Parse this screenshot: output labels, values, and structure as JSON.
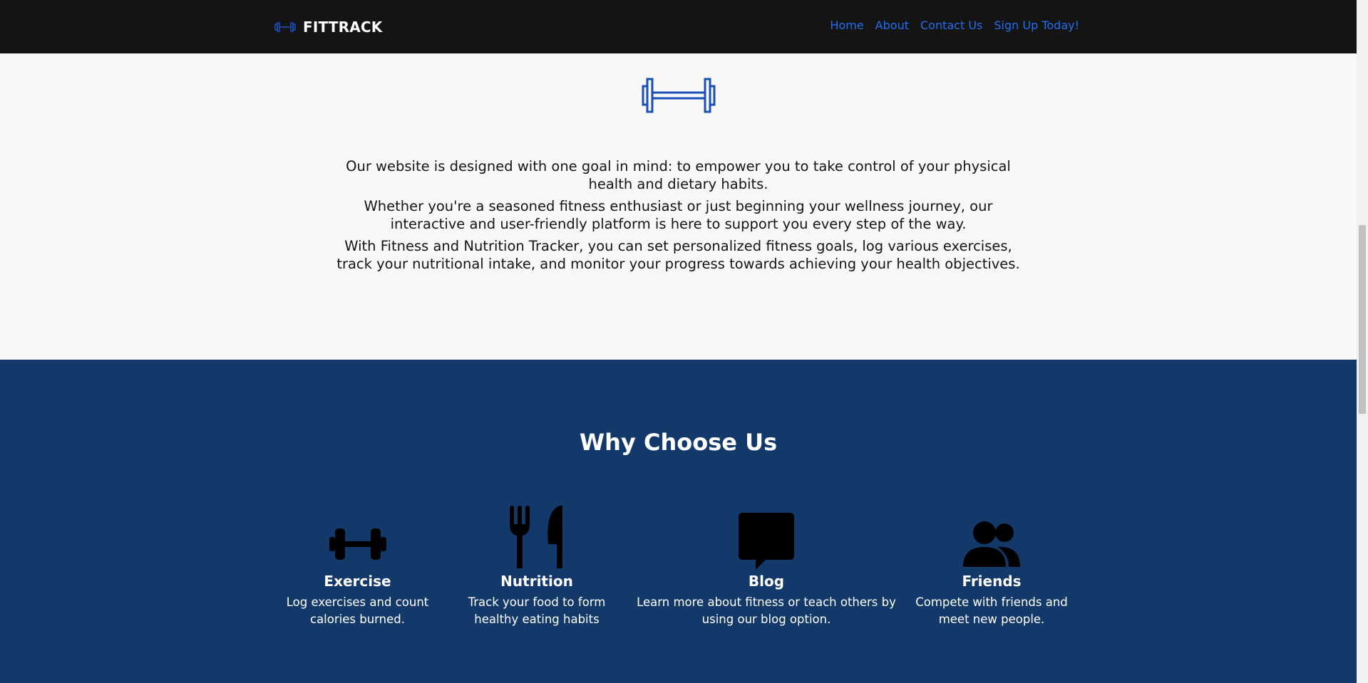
{
  "colors": {
    "nav_bg": "#141414",
    "accent": "#1f6ff0",
    "icon_blue": "#1a4fb6",
    "features_bg": "#13396b",
    "page_bg": "#f8f8f8"
  },
  "navbar": {
    "brand": {
      "icon": "dumbbell-icon",
      "text": "FITTRACK"
    },
    "links": [
      "Home",
      "About",
      "Contact Us",
      "Sign Up Today!"
    ]
  },
  "intro": {
    "icon": "dumbbell-outline-icon",
    "paragraphs": [
      "Our website is designed with one goal in mind: to empower you to take control of your physical health and dietary habits.",
      "Whether you're a seasoned fitness enthusiast or just beginning your wellness journey, our interactive and user-friendly platform is here to support you every step of the way.",
      "With Fitness and Nutrition Tracker, you can set personalized fitness goals, log various exercises, track your nutritional intake, and monitor your progress towards achieving your health objectives."
    ]
  },
  "features": {
    "title": "Why Choose Us",
    "items": [
      {
        "icon": "dumbbell-icon",
        "title": "Exercise",
        "desc": "Log exercises and count calories burned."
      },
      {
        "icon": "utensils-icon",
        "title": "Nutrition",
        "desc": "Track your food to form healthy eating habits"
      },
      {
        "icon": "chat-bubble-icon",
        "title": "Blog",
        "desc": "Learn more about fitness or teach others by using our blog option."
      },
      {
        "icon": "users-icon",
        "title": "Friends",
        "desc": "Compete with friends and meet new people."
      }
    ]
  }
}
